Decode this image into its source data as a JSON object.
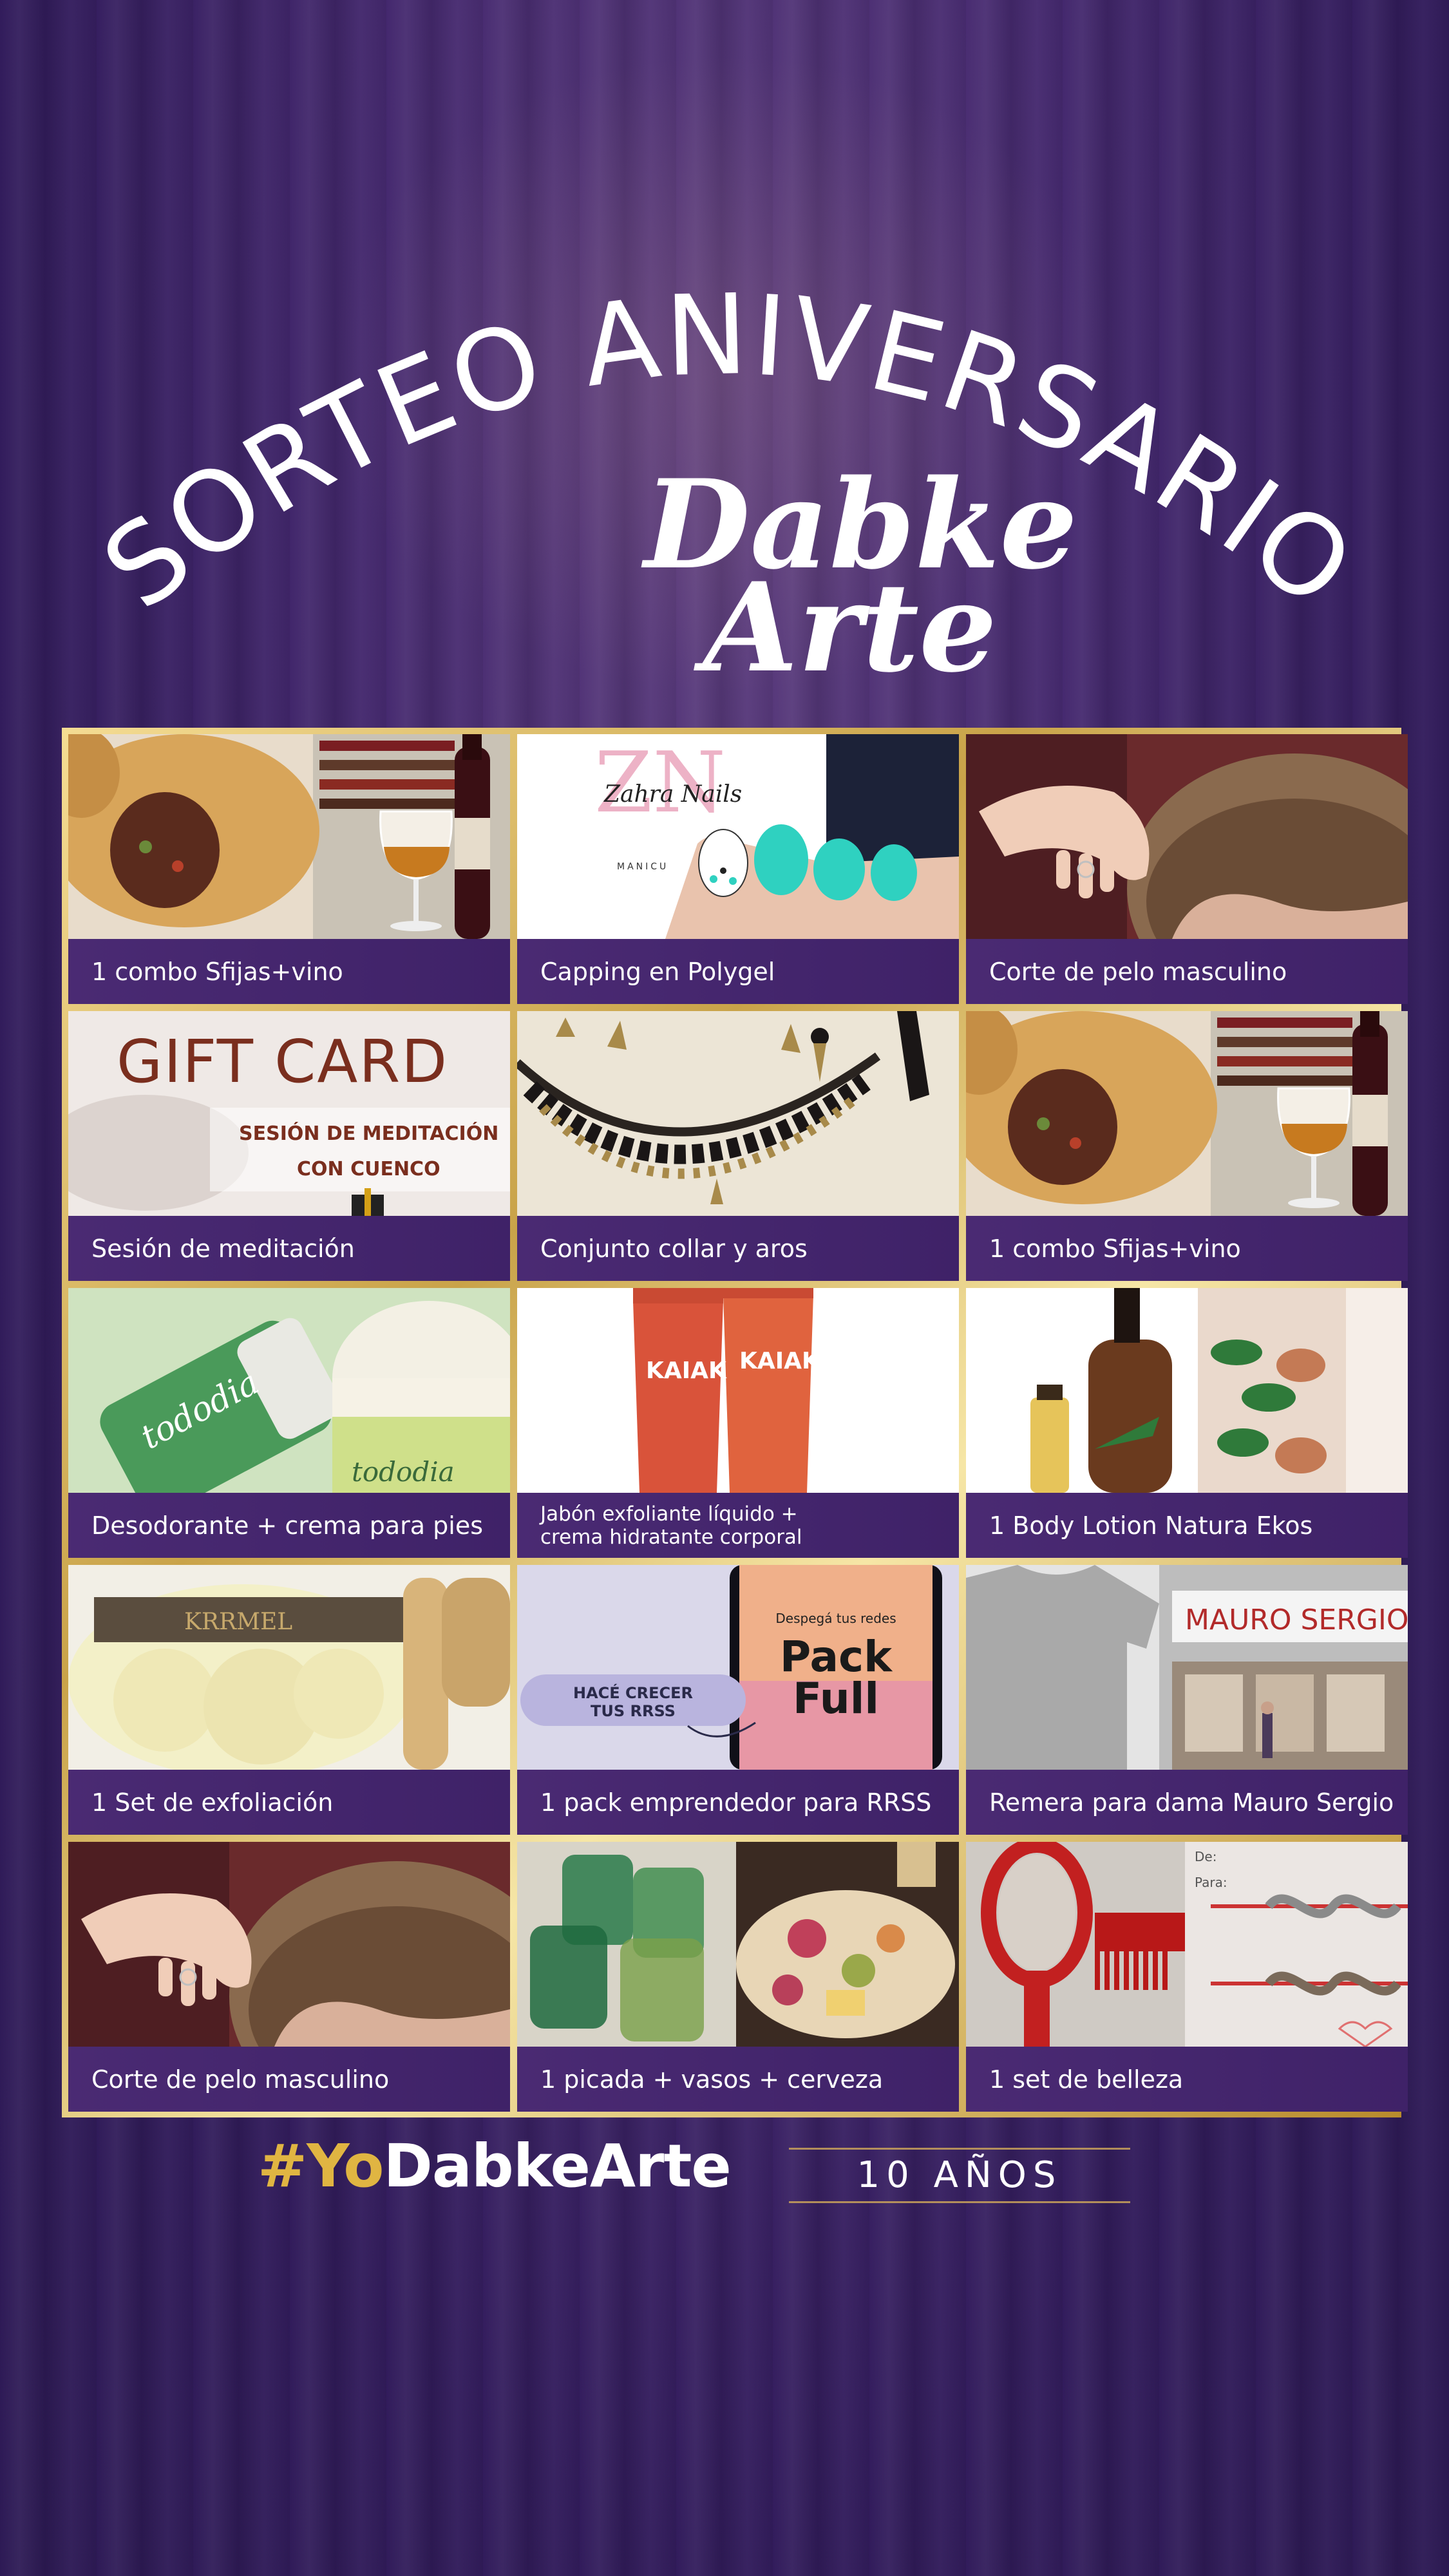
{
  "header": {
    "title": "SORTEO ANIVERSARIO",
    "brand_line1": "Dabke",
    "brand_line2": "Arte"
  },
  "prizes": [
    {
      "label": "1 combo Sfijas+vino",
      "image": "empanadas-and-wine"
    },
    {
      "label": "Capping en Polygel",
      "image": "zahra-nails-manicure"
    },
    {
      "label": "Corte de pelo masculino",
      "image": "haircut"
    },
    {
      "label": "Sesión de meditación",
      "image": "gift-card-meditation"
    },
    {
      "label": "Conjunto collar y aros",
      "image": "necklace"
    },
    {
      "label": "1 combo Sfijas+vino",
      "image": "empanadas-and-wine"
    },
    {
      "label": "Desodorante + crema para pies",
      "image": "tododia-foot-cream"
    },
    {
      "label_line1": "Jabón exfoliante líquido +",
      "label_line2": "crema hidratante corporal",
      "image": "kaiak-tubes"
    },
    {
      "label": "1 Body Lotion Natura Ekos",
      "image": "ekos-body-lotion"
    },
    {
      "label": "1 Set de exfoliación",
      "image": "exfoliation-set"
    },
    {
      "label": "1 pack emprendedor para RRSS",
      "image": "pack-full-phone"
    },
    {
      "label": "Remera para dama Mauro Sergio",
      "image": "tshirt-mauro-sergio"
    },
    {
      "label": "Corte de pelo masculino",
      "image": "haircut"
    },
    {
      "label": "1 picada + vasos + cerveza",
      "image": "glasses-and-picada"
    },
    {
      "label": "1 set de belleza",
      "image": "brush-and-bracelets"
    }
  ],
  "image_text": {
    "zahra_brand": "Zahra Nails",
    "zahra_sub": "MANICU",
    "gift_card": "GIFT CARD",
    "session_line1": "SESIÓN DE MEDITACIÓN",
    "session_line2": "CON CUENCO",
    "kaiak_brand": "KAIAK",
    "tododia_brand": "tododia",
    "krrmel": "KRRMEL",
    "pack_tagline": "Despegá tus redes",
    "pack_word1": "Pack",
    "pack_word2": "Full",
    "grow_line1": "HACÉ CRECER",
    "grow_line2": "TUS RRSS",
    "mauro_sergio": "MAURO SERGIO",
    "card_de": "De:",
    "card_para": "Para:"
  },
  "footer": {
    "hashtag_prefix": "#Yo",
    "hashtag_rest": "DabkeArte",
    "years": "10 AÑOS"
  },
  "colors": {
    "background": "#35205f",
    "caption_bar": "#4a2a73",
    "gold": "#e0b542"
  }
}
